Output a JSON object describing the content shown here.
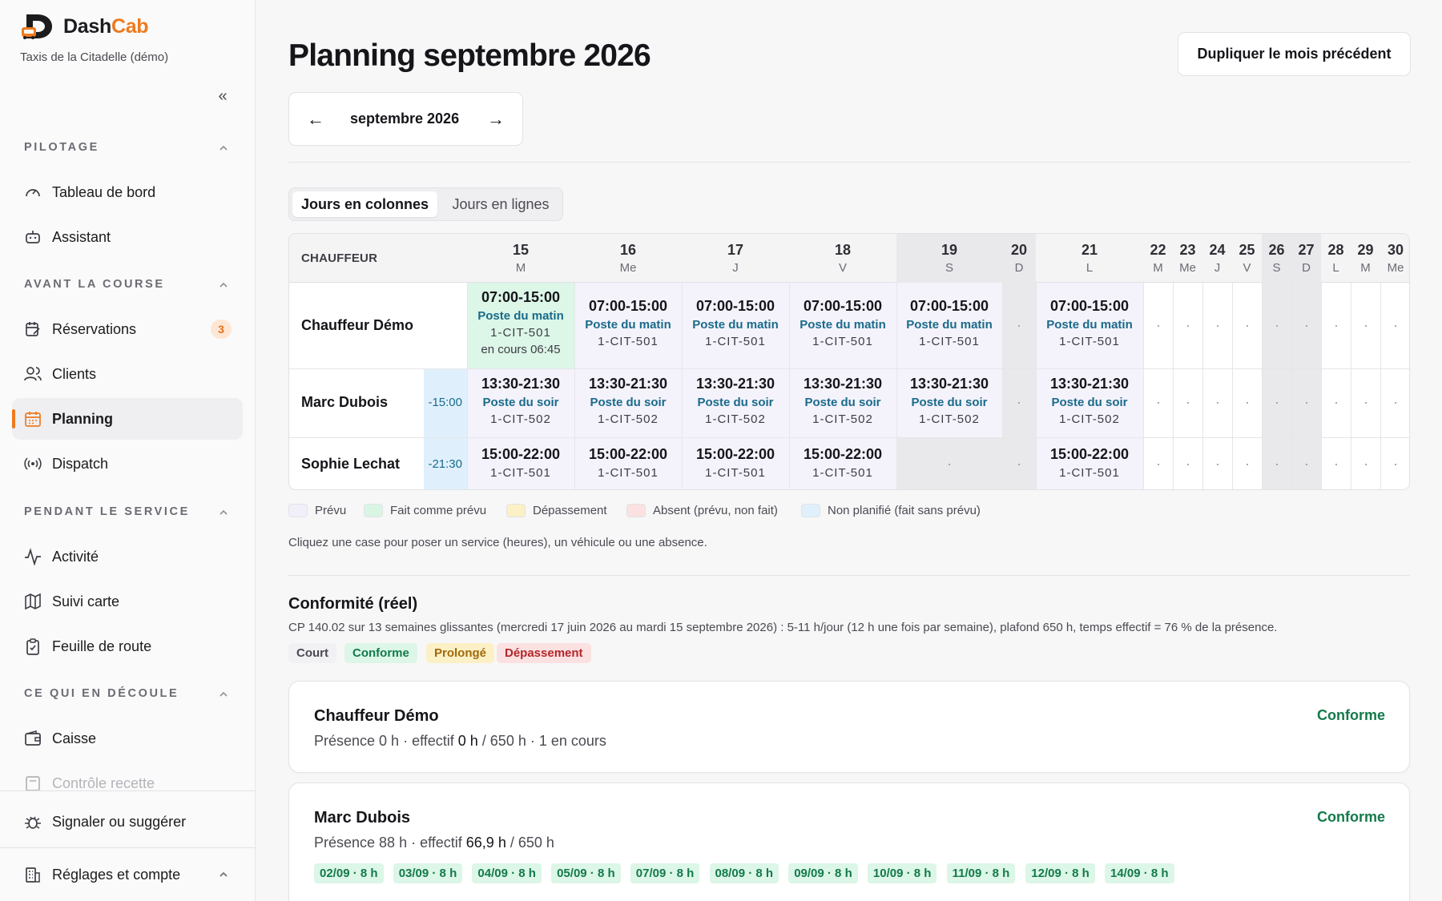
{
  "app": {
    "brand_part1": "Dash",
    "brand_part2": "Cab",
    "org": "Taxis de la Citadelle (démo)",
    "accent": "#ee7a1f"
  },
  "sidebar": {
    "collapse_icon": "chevrons-left-icon",
    "sections": [
      {
        "title": "PILOTAGE",
        "items": [
          {
            "label": "Tableau de bord",
            "icon": "gauge-icon"
          },
          {
            "label": "Assistant",
            "icon": "robot-icon"
          }
        ]
      },
      {
        "title": "AVANT LA COURSE",
        "items": [
          {
            "label": "Réservations",
            "icon": "edit-calendar-icon",
            "badge": "3"
          },
          {
            "label": "Clients",
            "icon": "users-icon"
          },
          {
            "label": "Planning",
            "icon": "calendar-icon",
            "active": true
          },
          {
            "label": "Dispatch",
            "icon": "broadcast-icon"
          }
        ]
      },
      {
        "title": "PENDANT LE SERVICE",
        "items": [
          {
            "label": "Activité",
            "icon": "activity-icon"
          },
          {
            "label": "Suivi carte",
            "icon": "map-icon"
          },
          {
            "label": "Feuille de route",
            "icon": "clipboard-icon"
          }
        ]
      },
      {
        "title": "CE QUI EN DÉCOULE",
        "items": [
          {
            "label": "Caisse",
            "icon": "wallet-icon"
          },
          {
            "label": "Contrôle recette",
            "icon": "receipt-icon"
          }
        ]
      }
    ],
    "footer": [
      {
        "label": "Signaler ou suggérer",
        "icon": "bug-icon"
      },
      {
        "label": "Réglages et compte",
        "icon": "building-icon"
      }
    ]
  },
  "main": {
    "title": "Planning septembre 2026",
    "duplicate_button": "Dupliquer le mois précédent",
    "month_label": "septembre 2026",
    "prev_arrow": "←",
    "next_arrow": "→",
    "view_toggle": [
      "Jours en colonnes",
      "Jours en lignes"
    ],
    "active_view": "Jours en colonnes"
  },
  "grid": {
    "driver_header": "CHAUFFEUR",
    "days": [
      {
        "num": "15",
        "dow": "M",
        "weekend": false
      },
      {
        "num": "16",
        "dow": "Me",
        "weekend": false
      },
      {
        "num": "17",
        "dow": "J",
        "weekend": false
      },
      {
        "num": "18",
        "dow": "V",
        "weekend": false
      },
      {
        "num": "19",
        "dow": "S",
        "weekend": true
      },
      {
        "num": "20",
        "dow": "D",
        "weekend": true
      },
      {
        "num": "21",
        "dow": "L",
        "weekend": false
      },
      {
        "num": "22",
        "dow": "M",
        "weekend": false
      },
      {
        "num": "23",
        "dow": "Me",
        "weekend": false
      },
      {
        "num": "24",
        "dow": "J",
        "weekend": false
      },
      {
        "num": "25",
        "dow": "V",
        "weekend": false
      },
      {
        "num": "26",
        "dow": "S",
        "weekend": true
      },
      {
        "num": "27",
        "dow": "D",
        "weekend": true
      },
      {
        "num": "28",
        "dow": "L",
        "weekend": false
      },
      {
        "num": "29",
        "dow": "M",
        "weekend": false
      },
      {
        "num": "30",
        "dow": "Me",
        "weekend": false
      }
    ],
    "rows": [
      {
        "driver": "Chauffeur Démo",
        "prev": "",
        "cells": [
          {
            "time": "07:00-15:00",
            "post": "Poste du matin",
            "vehicle": "1-CIT-501",
            "note": "en cours 06:45",
            "status": "done"
          },
          {
            "time": "07:00-15:00",
            "post": "Poste du matin",
            "vehicle": "1-CIT-501"
          },
          {
            "time": "07:00-15:00",
            "post": "Poste du matin",
            "vehicle": "1-CIT-501"
          },
          {
            "time": "07:00-15:00",
            "post": "Poste du matin",
            "vehicle": "1-CIT-501"
          },
          {
            "time": "07:00-15:00",
            "post": "Poste du matin",
            "vehicle": "1-CIT-501"
          },
          null,
          {
            "time": "07:00-15:00",
            "post": "Poste du matin",
            "vehicle": "1-CIT-501"
          }
        ]
      },
      {
        "driver": "Marc Dubois",
        "prev": "-15:00",
        "cells": [
          {
            "time": "13:30-21:30",
            "post": "Poste du soir",
            "vehicle": "1-CIT-502"
          },
          {
            "time": "13:30-21:30",
            "post": "Poste du soir",
            "vehicle": "1-CIT-502"
          },
          {
            "time": "13:30-21:30",
            "post": "Poste du soir",
            "vehicle": "1-CIT-502"
          },
          {
            "time": "13:30-21:30",
            "post": "Poste du soir",
            "vehicle": "1-CIT-502"
          },
          {
            "time": "13:30-21:30",
            "post": "Poste du soir",
            "vehicle": "1-CIT-502"
          },
          null,
          {
            "time": "13:30-21:30",
            "post": "Poste du soir",
            "vehicle": "1-CIT-502"
          }
        ]
      },
      {
        "driver": "Sophie Lechat",
        "prev": "-21:30",
        "cells": [
          {
            "time": "15:00-22:00",
            "vehicle": "1-CIT-501"
          },
          {
            "time": "15:00-22:00",
            "vehicle": "1-CIT-501"
          },
          {
            "time": "15:00-22:00",
            "vehicle": "1-CIT-501"
          },
          {
            "time": "15:00-22:00",
            "vehicle": "1-CIT-501"
          },
          null,
          null,
          {
            "time": "15:00-22:00",
            "vehicle": "1-CIT-501"
          }
        ]
      }
    ],
    "empty_mark": "·"
  },
  "legend": [
    {
      "label": "Prévu",
      "color": "#f1f0fa"
    },
    {
      "label": "Fait comme prévu",
      "color": "#d9f5e4"
    },
    {
      "label": "Dépassement",
      "color": "#fcf0c6"
    },
    {
      "label": "Absent (prévu, non fait)",
      "color": "#fbe1e1"
    },
    {
      "label": "Non planifié (fait sans prévu)",
      "color": "#dff0fc"
    }
  ],
  "hint": "Cliquez une case pour poser un service (heures), un véhicule ou une absence.",
  "compliance": {
    "title": "Conformité (réel)",
    "description": "CP 140.02 sur 13 semaines glissantes (mercredi 17 juin 2026 au mardi 15 septembre 2026) : 5-11 h/jour (12 h une fois par semaine), plafond 650 h, temps effectif = 76 % de la présence.",
    "categories": [
      "Court",
      "Conforme",
      "Prolongé",
      "Dépassement"
    ],
    "drivers": [
      {
        "name": "Chauffeur Démo",
        "status": "Conforme",
        "stat_prefix": "Présence 0 h · effectif ",
        "stat_effective": "0 h",
        "stat_suffix": " / 650 h · 1 en cours",
        "days": []
      },
      {
        "name": "Marc Dubois",
        "status": "Conforme",
        "stat_prefix": "Présence 88 h · effectif ",
        "stat_effective": "66,9 h",
        "stat_suffix": " / 650 h",
        "days": [
          "02/09 · 8 h",
          "03/09 · 8 h",
          "04/09 · 8 h",
          "05/09 · 8 h",
          "07/09 · 8 h",
          "08/09 · 8 h",
          "09/09 · 8 h",
          "10/09 · 8 h",
          "11/09 · 8 h",
          "12/09 · 8 h",
          "14/09 · 8 h"
        ]
      }
    ]
  }
}
